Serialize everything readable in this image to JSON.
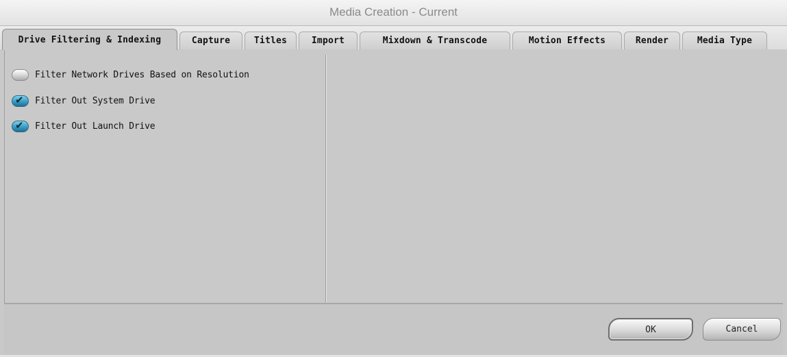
{
  "window": {
    "title": "Media Creation - Current"
  },
  "tabs": [
    {
      "label": "Drive Filtering & Indexing",
      "active": true
    },
    {
      "label": "Capture",
      "active": false
    },
    {
      "label": "Titles",
      "active": false
    },
    {
      "label": "Import",
      "active": false
    },
    {
      "label": "Mixdown & Transcode",
      "active": false
    },
    {
      "label": "Motion Effects",
      "active": false
    },
    {
      "label": "Render",
      "active": false
    },
    {
      "label": "Media Type",
      "active": false
    }
  ],
  "options": [
    {
      "label": "Filter Network Drives Based on Resolution",
      "checked": false
    },
    {
      "label": "Filter Out System Drive",
      "checked": true
    },
    {
      "label": "Filter Out Launch Drive",
      "checked": true
    }
  ],
  "buttons": {
    "ok_label": "OK",
    "cancel_label": "Cancel"
  },
  "icons": {
    "checkmark": "checkmark-icon"
  },
  "colors": {
    "checkbox_on": "#3b9bc2",
    "panel_bg": "#c9c9c9"
  }
}
